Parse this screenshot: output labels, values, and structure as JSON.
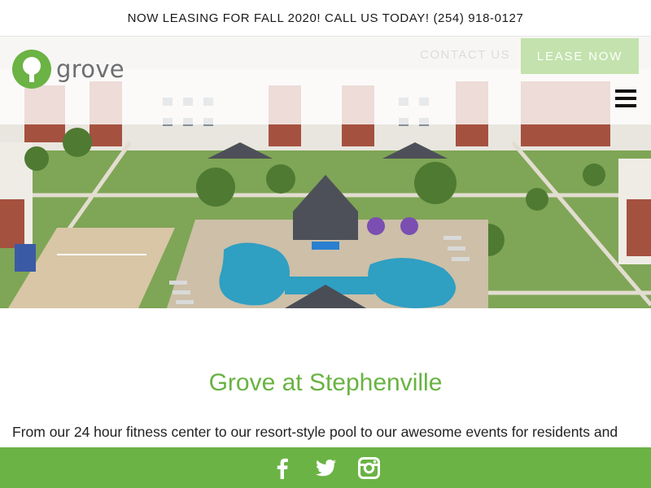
{
  "announcement": {
    "text": "NOW LEASING FOR FALL 2020! CALL US TODAY! (254) 918-0127"
  },
  "header": {
    "logo_text": "grove",
    "contact_label": "CONTACT US",
    "lease_label": "LEASE NOW"
  },
  "main": {
    "title": "Grove at Stephenville",
    "intro": "From our 24 hour fitness center to our resort-style pool to our awesome events for residents and"
  },
  "social": {
    "icons": [
      "facebook-icon",
      "twitter-icon",
      "instagram-icon"
    ]
  },
  "colors": {
    "brand_green": "#6ab344",
    "title_green": "#69b342",
    "lease_button": "#c3e2ad",
    "logo_gray": "#6d6e70"
  }
}
